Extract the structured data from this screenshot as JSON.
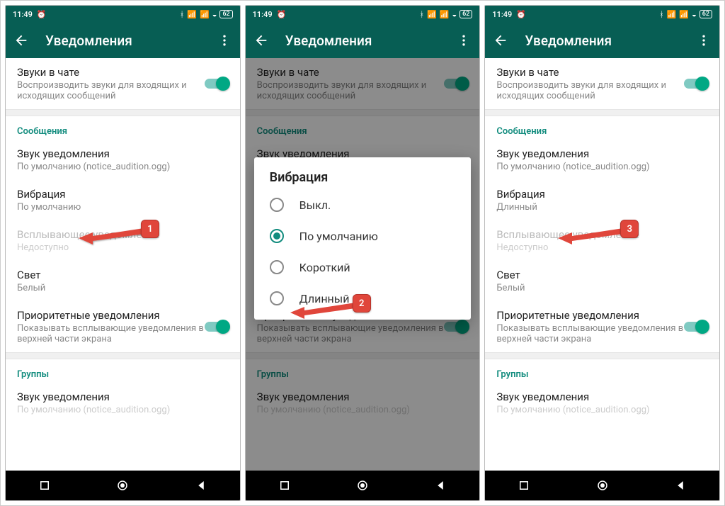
{
  "status": {
    "time": "11:49",
    "battery": "62"
  },
  "appbar": {
    "title": "Уведомления"
  },
  "chat_sounds": {
    "title": "Звуки в чате",
    "sub": "Воспроизводить звуки для входящих и исходящих сообщений"
  },
  "messages_header": "Сообщения",
  "notif_sound": {
    "title": "Звук уведомления",
    "sub": "По умолчанию (notice_audition.ogg)"
  },
  "vibration": {
    "title": "Вибрация",
    "sub_default": "По умолчанию",
    "sub_long": "Длинный"
  },
  "popup": {
    "title": "Всплывающее уведомление",
    "sub": "Недоступно"
  },
  "light": {
    "title": "Свет",
    "sub": "Белый"
  },
  "priority": {
    "title": "Приоритетные уведомления",
    "sub": "Показывать всплывающие уведомления в верхней части экрана"
  },
  "groups_header": "Группы",
  "groups_sound": {
    "title": "Звук уведомления",
    "sub": "По умолчанию (notice_audition.ogg)"
  },
  "dialog": {
    "title": "Вибрация",
    "options": [
      "Выкл.",
      "По умолчанию",
      "Короткий",
      "Длинный"
    ]
  },
  "annotations": {
    "a1": "1",
    "a2": "2",
    "a3": "3"
  }
}
